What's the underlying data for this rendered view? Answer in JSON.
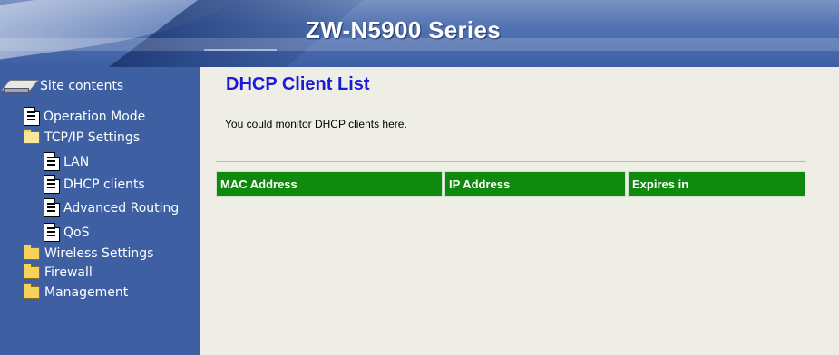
{
  "header": {
    "title": "ZW-N5900 Series"
  },
  "sidebar": {
    "root_label": "Site contents",
    "items": [
      {
        "label": "Operation Mode",
        "icon": "document-icon"
      },
      {
        "label": "TCP/IP Settings",
        "icon": "open-folder-icon"
      },
      {
        "label": "LAN",
        "icon": "document-icon"
      },
      {
        "label": "DHCP clients",
        "icon": "document-icon"
      },
      {
        "label": "Advanced Routing",
        "icon": "document-icon"
      },
      {
        "label": "QoS",
        "icon": "document-icon"
      },
      {
        "label": "Wireless Settings",
        "icon": "folder-icon"
      },
      {
        "label": "Firewall",
        "icon": "folder-icon"
      },
      {
        "label": "Management",
        "icon": "folder-icon"
      }
    ]
  },
  "main": {
    "title": "DHCP Client List",
    "description": "You could monitor DHCP clients here.",
    "table": {
      "columns": [
        "MAC Address",
        "IP Address",
        "Expires in"
      ]
    }
  },
  "colors": {
    "header_bg": "#4a69ab",
    "sidebar_bg": "#3e60a3",
    "content_bg": "#efeee6",
    "title_blue": "#1b1bd6",
    "table_header_green": "#0f8a0f"
  }
}
